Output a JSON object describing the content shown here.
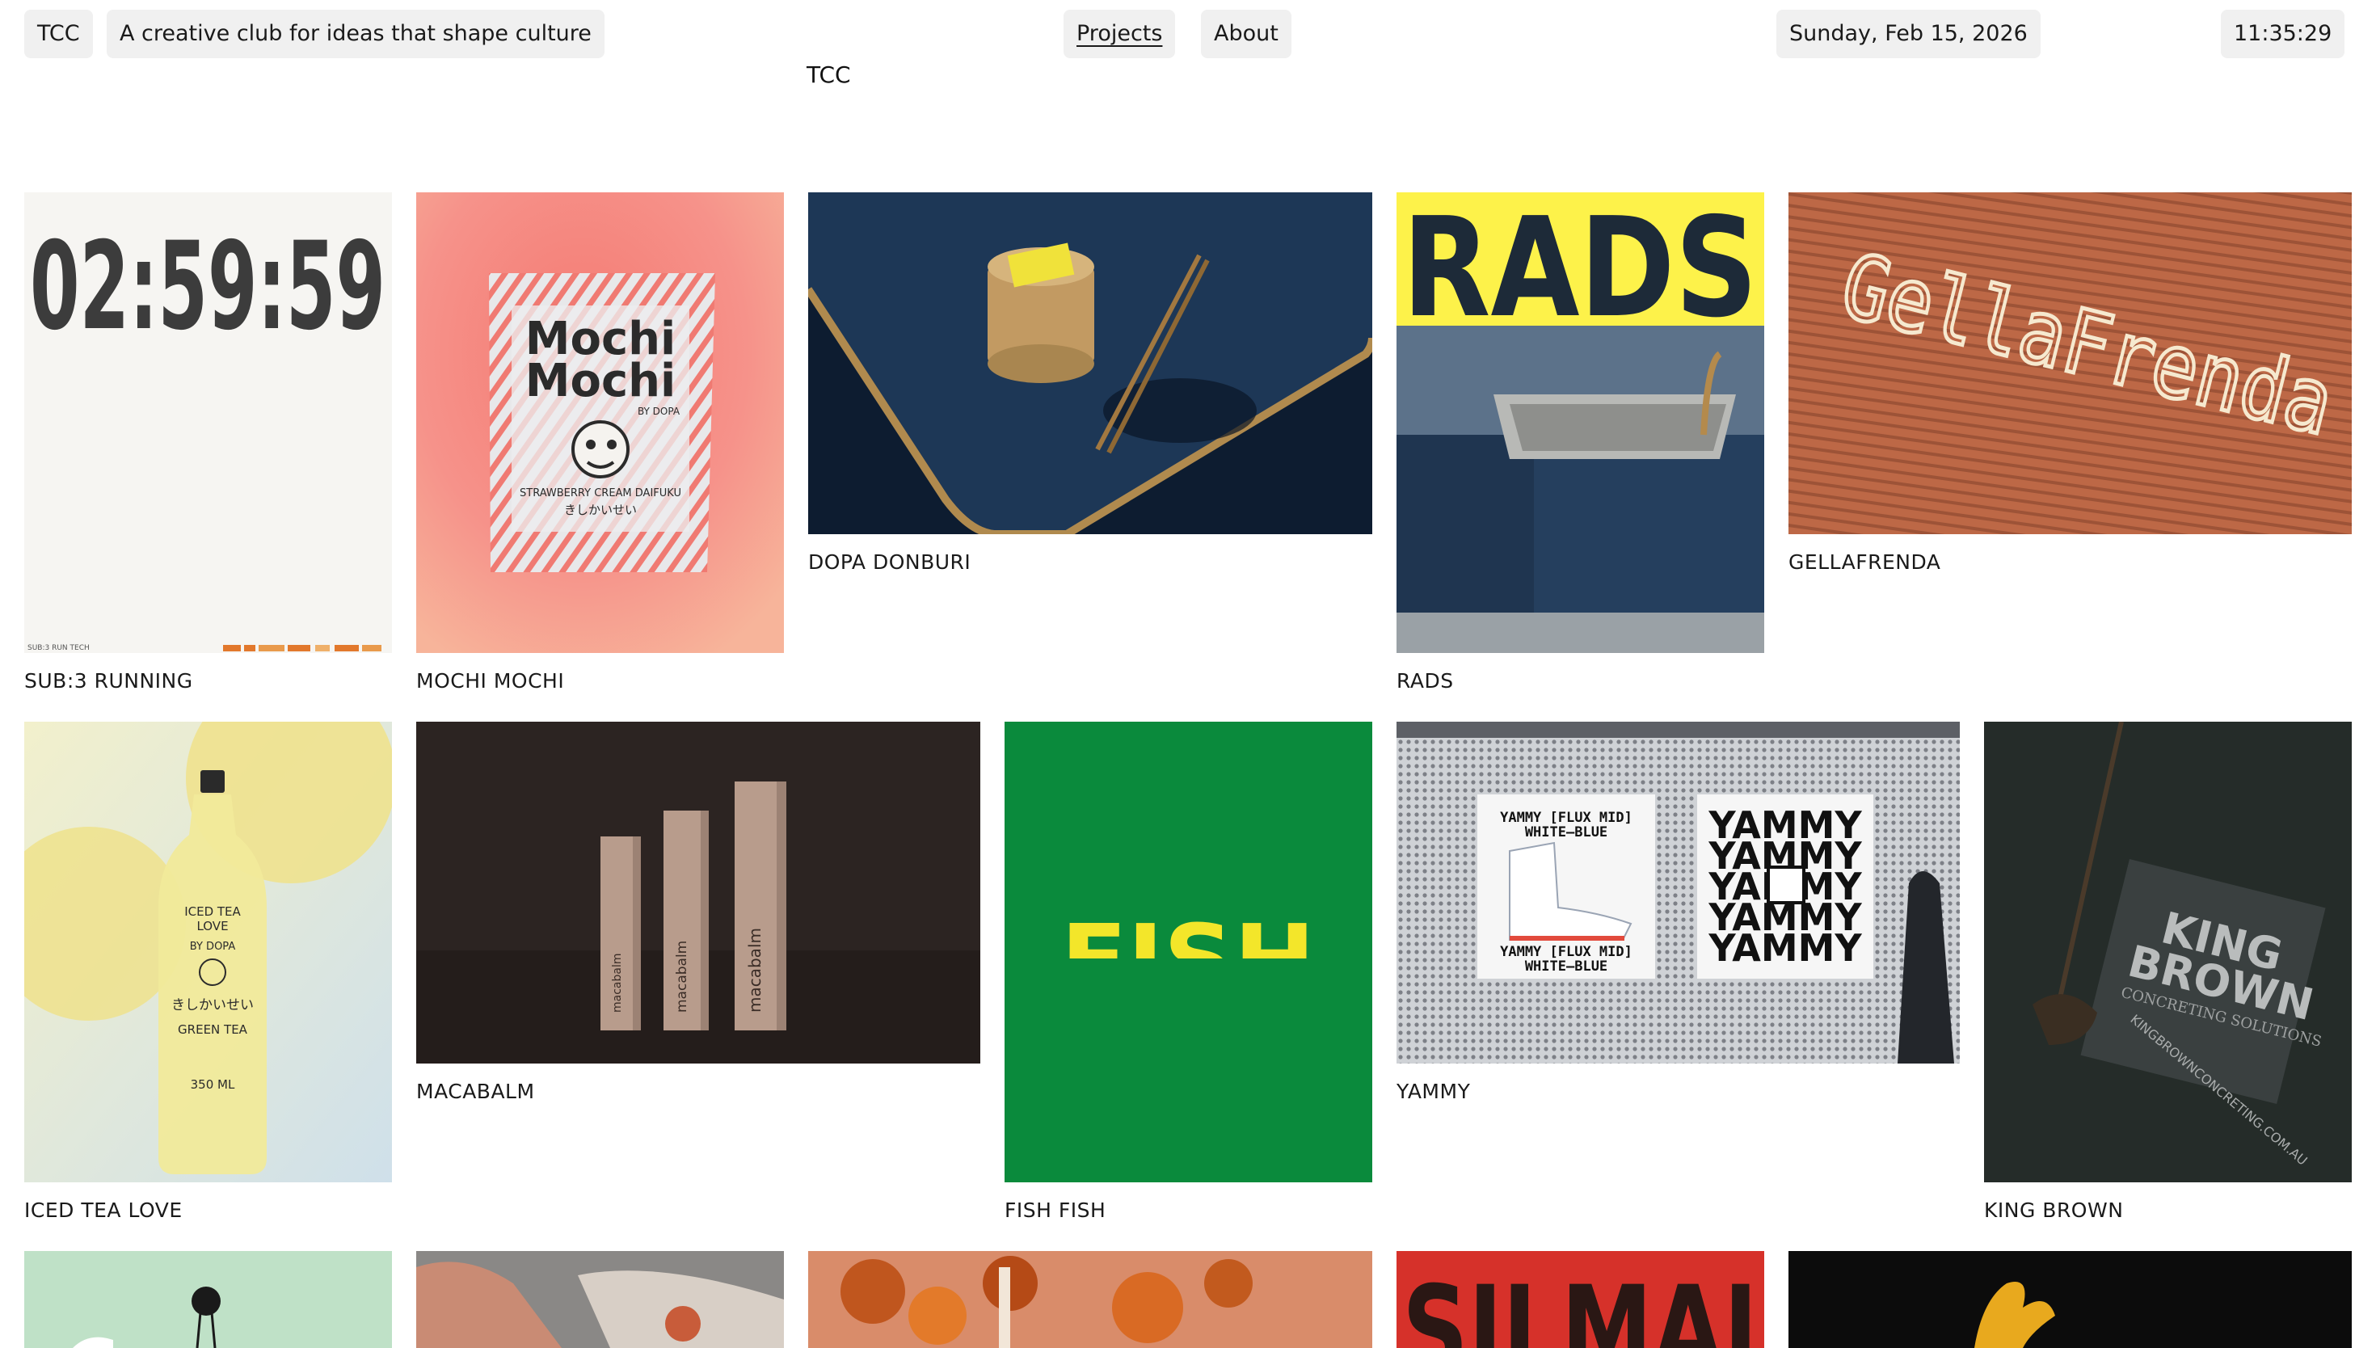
{
  "header": {
    "logo": "TCC",
    "tagline": "A creative club for ideas that shape culture",
    "nav": {
      "projects": "Projects",
      "about": "About"
    },
    "date": "Sunday, Feb 15, 2026",
    "time": "11:35:29",
    "subtitle": "TCC"
  },
  "projects": [
    {
      "title": "SUB:3 RUNNING",
      "art": {
        "big": "02:59:59",
        "small": "SUB:3 RUN TECH"
      }
    },
    {
      "title": "MOCHI MOCHI",
      "art": {
        "line1": "Mochi",
        "line2": "Mochi",
        "by": "BY DOPA",
        "flavor": "STRAWBERRY CREAM   DAIFUKU",
        "jp": "きしかいせい"
      }
    },
    {
      "title": "DOPA DONBURI"
    },
    {
      "title": "RADS",
      "art": {
        "word": "RADS"
      }
    },
    {
      "title": "GELLAFRENDA",
      "art": {
        "word": "GellaFrenda"
      }
    },
    {
      "title": "ICED TEA LOVE",
      "art": {
        "line1": "ICED  TEA",
        "line2": "LOVE",
        "by": "BY   DOPA",
        "jp": "きしかいせい",
        "sub": "GREEN  TEA",
        "vol": "350 ML"
      }
    },
    {
      "title": "MACABALM",
      "art": {
        "word": "macabalm"
      }
    },
    {
      "title": "FISH FISH",
      "art": {
        "word": "FISH"
      }
    },
    {
      "title": "YAMMY",
      "art": {
        "poster_l1": "YAMMY [FLUX MID]",
        "poster_l2": "WHITE—BLUE",
        "big": "YAMMY"
      }
    },
    {
      "title": "KING BROWN",
      "art": {
        "l1": "KING",
        "l2": "BROWN",
        "l3": "CONCRETING SOLUTIONS",
        "url": "KINGBROWNCONCRETING.COM.AU"
      }
    },
    {
      "title": ""
    },
    {
      "title": ""
    },
    {
      "title": ""
    },
    {
      "title": "",
      "art": {
        "word": "SILMAI"
      }
    },
    {
      "title": ""
    }
  ],
  "colors": {
    "fish_green": "#0a8a3c",
    "fish_yellow": "#f3e62a",
    "rads_yellow": "#fdf24a",
    "silmai_red": "#d6312a"
  }
}
